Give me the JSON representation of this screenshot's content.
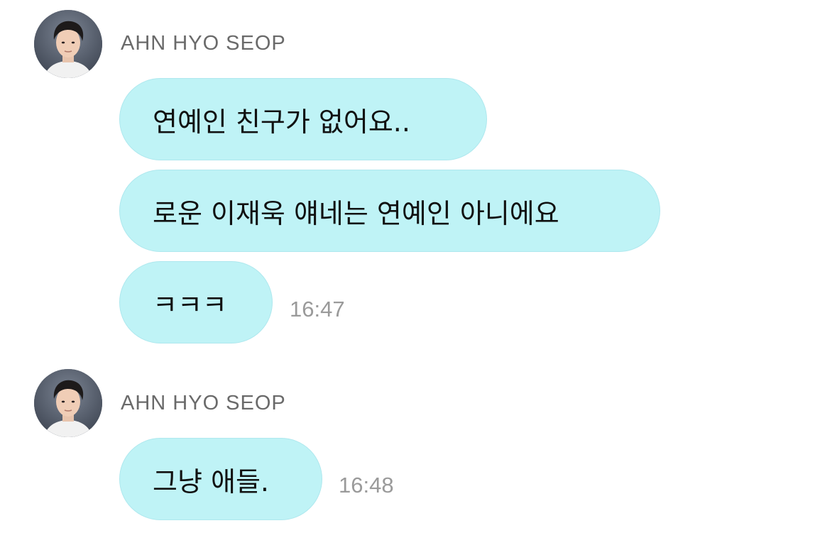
{
  "groups": [
    {
      "sender": "AHN HYO SEOP",
      "avatar_icon": "profile-photo",
      "messages": [
        {
          "text": "연예인 친구가 없어요..",
          "time": ""
        },
        {
          "text": "로운 이재욱 얘네는 연예인 아니에요",
          "time": ""
        },
        {
          "text": "ㅋㅋㅋ",
          "time": "16:47"
        }
      ]
    },
    {
      "sender": "AHN HYO SEOP",
      "avatar_icon": "profile-photo",
      "messages": [
        {
          "text": "그냥 애들.",
          "time": "16:48"
        }
      ]
    }
  ],
  "colors": {
    "bubble": "#bff3f6",
    "sender": "#6a6a6a",
    "time": "#9a9a9a"
  }
}
